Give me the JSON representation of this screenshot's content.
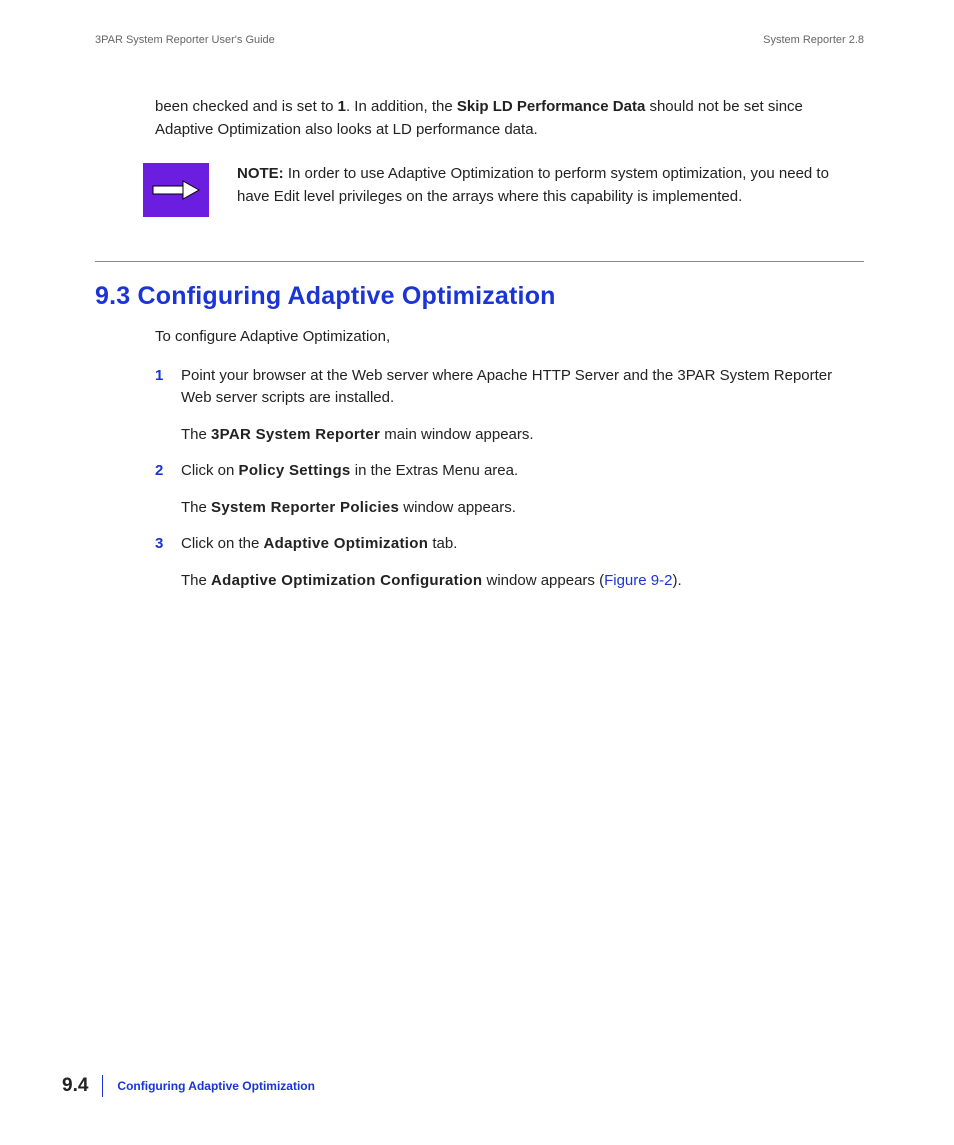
{
  "header": {
    "left": "3PAR System Reporter User's Guide",
    "right": "System Reporter 2.8"
  },
  "intro": {
    "pre": "been checked and is set to ",
    "bold1": "1",
    "mid": ". In addition, the ",
    "bold2": "Skip LD Performance Data",
    "post": " should not be set since Adaptive Optimization also looks at LD performance data."
  },
  "note": {
    "label": "NOTE:",
    "text": " In order to use Adaptive Optimization to perform system optimization, you need to have Edit level privileges on the arrays where this capability is implemented."
  },
  "section": {
    "heading": "9.3 Configuring Adaptive Optimization",
    "lead": "To configure Adaptive Optimization,"
  },
  "steps": [
    {
      "p1_pre": "Point your browser at the Web server where Apache HTTP Server and the 3PAR System Reporter Web server scripts are installed.",
      "p2_pre": "The ",
      "p2_bold": "3PAR System Reporter",
      "p2_post": " main window appears."
    },
    {
      "p1_pre": "Click on ",
      "p1_bold": "Policy Settings",
      "p1_post": " in the Extras Menu area.",
      "p2_pre": "The ",
      "p2_bold": "System Reporter Policies",
      "p2_post": " window appears."
    },
    {
      "p1_pre": "Click on the ",
      "p1_bold": "Adaptive Optimization",
      "p1_post": " tab.",
      "p2_pre": "The ",
      "p2_bold": "Adaptive Optimization Configuration",
      "p2_post_a": " window appears (",
      "p2_link": "Figure 9-2",
      "p2_post_b": ")."
    }
  ],
  "footer": {
    "page": "9.4",
    "title": "Configuring Adaptive Optimization"
  }
}
